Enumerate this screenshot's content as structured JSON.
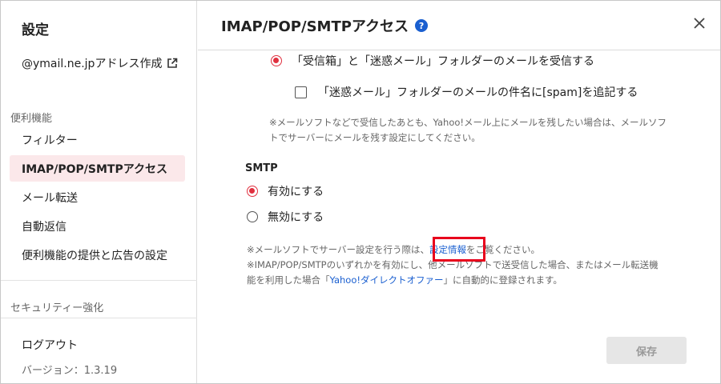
{
  "sidebar": {
    "title": "設定",
    "address_link": "@ymail.ne.jpアドレス作成",
    "section_convenience": "便利機能",
    "items": [
      {
        "label": "フィルター"
      },
      {
        "label": "IMAP/POP/SMTPアクセス"
      },
      {
        "label": "メール転送"
      },
      {
        "label": "自動返信"
      },
      {
        "label": "便利機能の提供と広告の設定"
      }
    ],
    "section_security": "セキュリティー強化",
    "logout": "ログアウト",
    "version": "バージョン：1.3.19"
  },
  "main": {
    "title": "IMAP/POP/SMTPアクセス",
    "pop_receive_option": "「受信箱」と「迷惑メール」フォルダーのメールを受信する",
    "spam_tag_option": "「迷惑メール」フォルダーのメールの件名に[spam]を追記する",
    "pop_note_line1": "※メールソフトなどで受信したあとも、Yahoo!メール上にメールを残したい場合は、メールソフ",
    "pop_note_line2": "トでサーバーにメールを残す設定にしてください。",
    "smtp_label": "SMTP",
    "smtp_enable": "有効にする",
    "smtp_disable": "無効にする",
    "note1_prefix": "※メールソフトでサーバー設定を行う際は、",
    "note1_link": "設定情報",
    "note1_suffix": "をご覧ください。",
    "note2_line1": "※IMAP/POP/SMTPのいずれかを有効にし、他メールソフトで送受信した場合、またはメール転送機",
    "note2_prefix": "能を利用した場合「",
    "note2_link": "Yahoo!ダイレクトオファー",
    "note2_suffix": "」に自動的に登録されます。",
    "save_label": "保存"
  },
  "colors": {
    "accent": "#e0303f",
    "link": "#1a5fd0",
    "active_bg": "#fbe8ea",
    "highlight": "#e8001c"
  },
  "state": {
    "pop_receive": "selected",
    "spam_tag": "unchecked",
    "smtp": "有効にする"
  }
}
